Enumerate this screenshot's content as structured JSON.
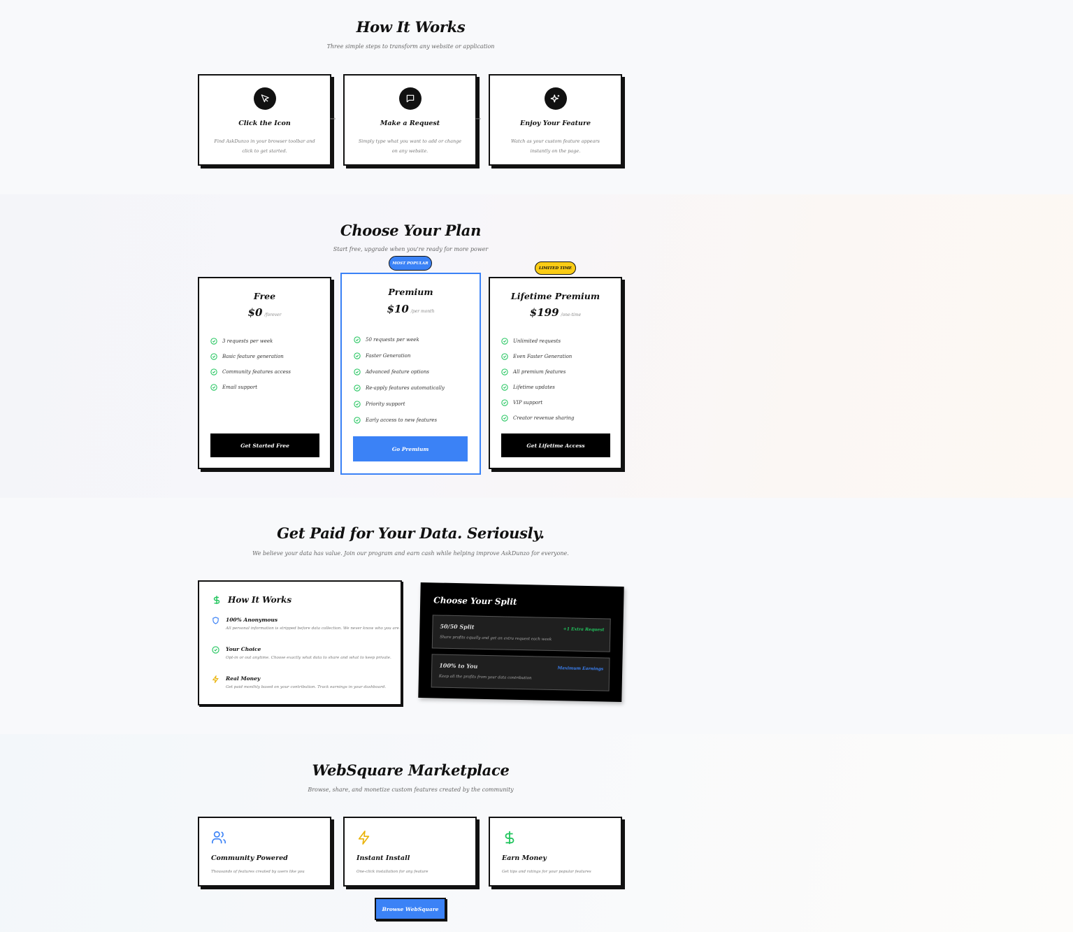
{
  "how": {
    "title": "How It Works",
    "subtitle": "Three simple steps to transform any website or application",
    "steps": [
      {
        "title": "Click the Icon",
        "desc": "Find AskDunzo in your browser toolbar and click to get started.",
        "icon": "cursor-icon"
      },
      {
        "title": "Make a Request",
        "desc": "Simply type what you want to add or change on any website.",
        "icon": "chat-bubble-icon"
      },
      {
        "title": "Enjoy Your Feature",
        "desc": "Watch as your custom feature appears instantly on the page.",
        "icon": "sparkles-icon"
      }
    ]
  },
  "plans": {
    "title": "Choose Your Plan",
    "subtitle": "Start free, upgrade when you're ready for more power",
    "items": [
      {
        "name": "Free",
        "price": "$0",
        "period": "/forever",
        "badge": "",
        "features": [
          "3 requests per week",
          "Basic feature generation",
          "Community features access",
          "Email support"
        ],
        "button": "Get Started Free"
      },
      {
        "name": "Premium",
        "price": "$10",
        "period": "/per month",
        "badge": "MOST POPULAR",
        "features": [
          "50 requests per week",
          "Faster Generation",
          "Advanced feature options",
          "Re-apply features automatically",
          "Priority support",
          "Early access to new features"
        ],
        "button": "Go Premium"
      },
      {
        "name": "Lifetime Premium",
        "price": "$199",
        "period": "/one-time",
        "badge": "LIMITED TIME",
        "features": [
          "Unlimited requests",
          "Even Faster Generation",
          "All premium features",
          "Lifetime updates",
          "VIP support",
          "Creator revenue sharing"
        ],
        "button": "Get Lifetime Access"
      }
    ]
  },
  "paid": {
    "title": "Get Paid for Your Data. Seriously.",
    "subtitle": "We believe your data has value. Join our program and earn cash while helping improve AskDunzo for everyone.",
    "card_title": "How It Works",
    "items": [
      {
        "title": "100% Anonymous",
        "desc": "All personal information is stripped before data collection. We never know who you are.",
        "icon": "shield-icon"
      },
      {
        "title": "Your Choice",
        "desc": "Opt-in or out anytime. Choose exactly what data to share and what to keep private.",
        "icon": "check-circle-icon"
      },
      {
        "title": "Real Money",
        "desc": "Get paid monthly based on your contribution. Track earnings in your dashboard.",
        "icon": "lightning-icon"
      }
    ],
    "split": {
      "title": "Choose Your Split",
      "options": [
        {
          "title": "50/50 Split",
          "tag": "+1 Extra Request",
          "desc": "Share profits equally and get an extra request each week"
        },
        {
          "title": "100% to You",
          "tag": "Maximum Earnings",
          "desc": "Keep all the profits from your data contribution"
        }
      ]
    }
  },
  "market": {
    "title": "WebSquare Marketplace",
    "subtitle": "Browse, share, and monetize custom features created by the community",
    "cards": [
      {
        "title": "Community Powered",
        "desc": "Thousands of features created by users like you",
        "icon": "users-icon"
      },
      {
        "title": "Instant Install",
        "desc": "One-click installation for any feature",
        "icon": "lightning-icon"
      },
      {
        "title": "Earn Money",
        "desc": "Get tips and ratings for your popular features",
        "icon": "dollar-icon"
      }
    ],
    "button": "Browse WebSquare"
  },
  "colors": {
    "accent": "#3b82f6",
    "success": "#22c55e",
    "warning": "#facc15",
    "ink": "#111111"
  }
}
